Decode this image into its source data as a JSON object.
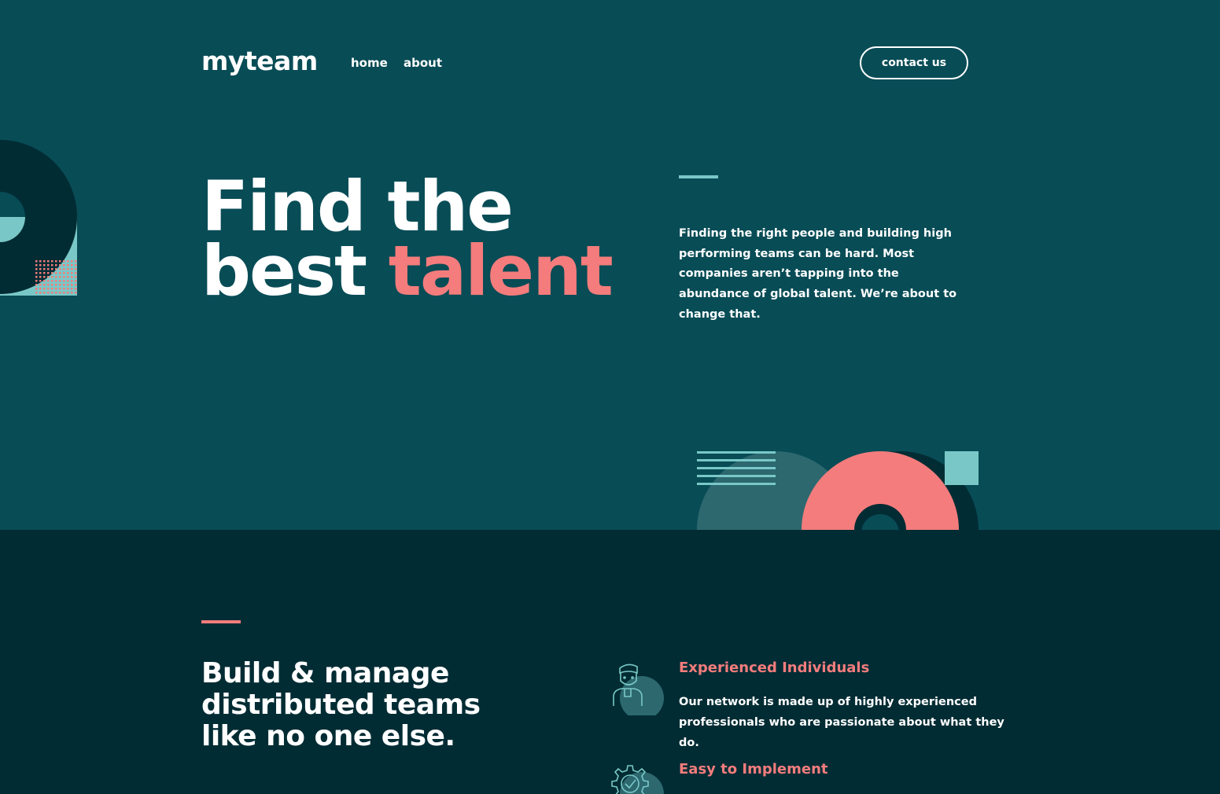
{
  "header": {
    "logo": "myteam",
    "nav": [
      "home",
      "about"
    ],
    "cta_label": "contact us"
  },
  "hero": {
    "headline_line1": "Find the",
    "headline_line2_plain": "best ",
    "headline_line2_accent": "talent",
    "body": "Finding the right people and building high performing teams can be hard. Most companies aren’t tapping into the abundance of global talent. We’re about to change that."
  },
  "section": {
    "title": "Build & manage distributed teams like no one else.",
    "features": [
      {
        "icon": "person-icon",
        "title": "Experienced Individuals",
        "text": "Our network is made up of highly experienced professionals who are passionate about what they do."
      },
      {
        "icon": "cog-check-icon",
        "title": "Easy to Implement",
        "text": ""
      }
    ]
  },
  "colors": {
    "hero_bg": "#084c56",
    "section_bg": "#022c34",
    "accent_coral": "#f47c7c",
    "accent_teal": "#79c8c7",
    "text": "#ffffff"
  }
}
